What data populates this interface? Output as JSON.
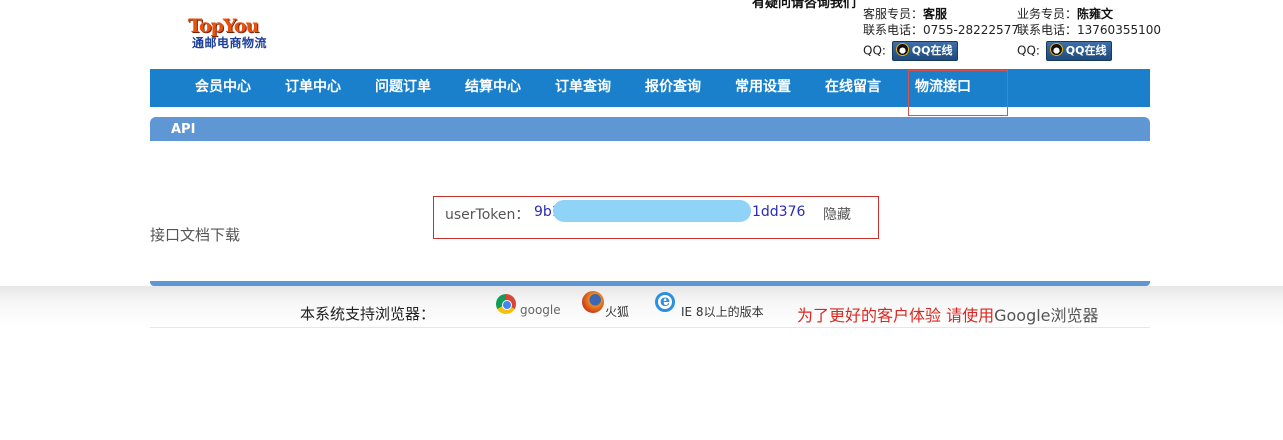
{
  "header": {
    "logo_top": "TopYou",
    "logo_sub": "通邮电商物流",
    "slogan": "有疑问请咨询我们",
    "service": {
      "rep_label": "客服专员：",
      "rep_name": "客服",
      "phone_label": "联系电话：",
      "phone": "0755-28222577",
      "qq_label": "QQ:",
      "qq_button": "QQ在线"
    },
    "sales": {
      "rep_label": "业务专员：",
      "rep_name": "陈雍文",
      "phone_label": "联系电话：",
      "phone": "13760355100",
      "qq_label": "QQ:",
      "qq_button": "QQ在线"
    }
  },
  "nav": {
    "items": [
      "会员中心",
      "订单中心",
      "问题订单",
      "结算中心",
      "订单查询",
      "报价查询",
      "常用设置",
      "在线留言",
      "物流接口"
    ],
    "active": "物流接口"
  },
  "panel": {
    "title": "API",
    "doc_link": "接口文档下载",
    "token_label": "userToken：",
    "token_start": "9b1",
    "token_end": "1dd376",
    "hide_label": "隐藏"
  },
  "footer": {
    "label": "本系统支持浏览器：",
    "browsers": [
      {
        "icon": "chrome-icon",
        "name": "google"
      },
      {
        "icon": "firefox-icon",
        "name": "火狐"
      },
      {
        "icon": "ie-icon",
        "name": "IE 8以上的版本"
      }
    ],
    "tip_prefix": "为了更好的客户体验 请使用",
    "tip_brand": "Google",
    "tip_suffix": "浏览器"
  }
}
